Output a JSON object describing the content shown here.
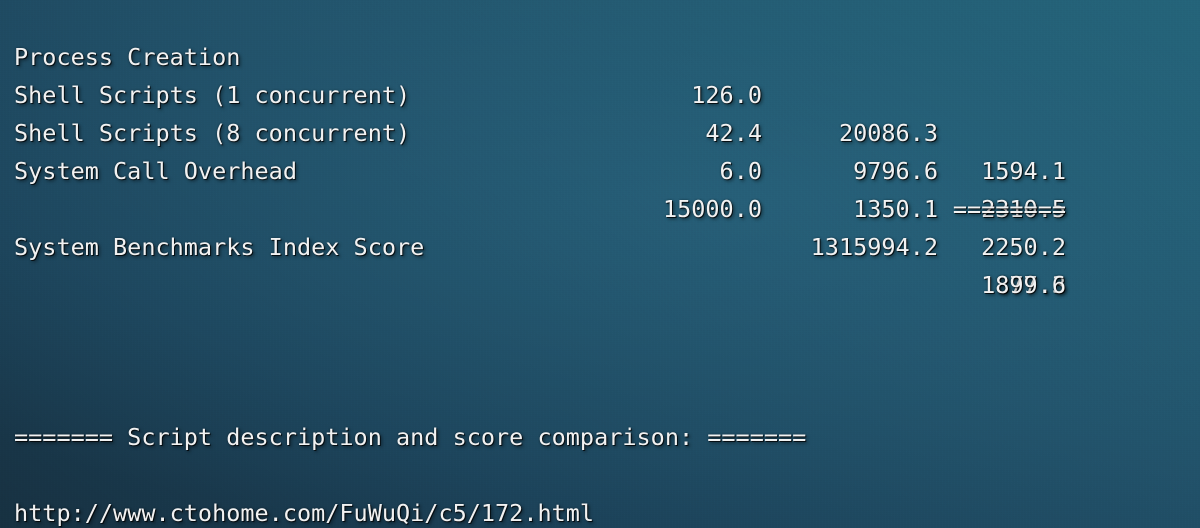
{
  "terminal": {
    "colors": {
      "background_dark": "#173141",
      "background_light": "#236378",
      "text": "#f2f2f2"
    }
  },
  "benchmark": {
    "rows": [
      {
        "name": "Process Creation",
        "index": "126.0",
        "value": "20086.3",
        "score": "1594.1"
      },
      {
        "name": "Shell Scripts (1 concurrent)",
        "index": "42.4",
        "value": "9796.6",
        "score": "2310.5"
      },
      {
        "name": "Shell Scripts (8 concurrent)",
        "index": "6.0",
        "value": "1350.1",
        "score": "2250.2"
      },
      {
        "name": "System Call Overhead",
        "index": "15000.0",
        "value": "1315994.2",
        "score": "877.3"
      }
    ],
    "separator": "========",
    "summary_label": "System Benchmarks Index Score",
    "summary_value": "1899.6"
  },
  "footer": {
    "section_heading": "======= Script description and score comparison: =======",
    "url": "http://www.ctohome.com/FuWuQi/c5/172.html"
  }
}
